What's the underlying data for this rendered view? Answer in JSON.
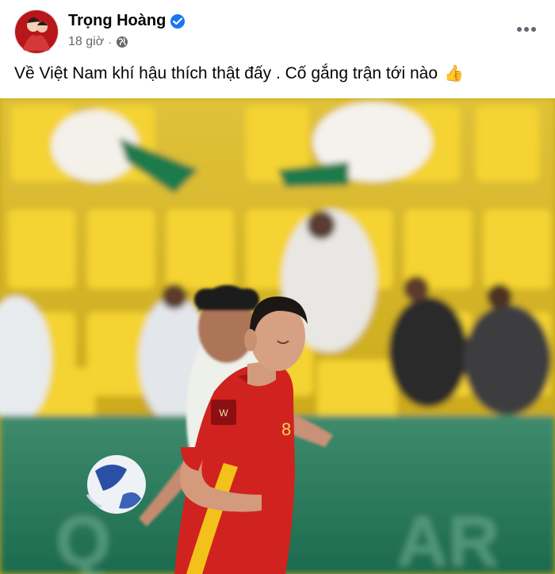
{
  "post": {
    "author_name": "Trọng Hoàng",
    "timestamp": "18 giờ",
    "separator": "·",
    "privacy_icon": "globe-icon",
    "verified_icon": "verified-badge-icon",
    "more_icon": "more-options-icon",
    "caption": "Về Việt Nam khí hậu thích thật đấy . Cố gắng trận tới nào",
    "caption_emoji": "👍"
  },
  "photo": {
    "jersey_number": "8"
  },
  "colors": {
    "verified": "#1877f2",
    "meta_text": "#65676b",
    "stadium_seats": "#e0c020",
    "jersey_red": "#d0231f"
  }
}
